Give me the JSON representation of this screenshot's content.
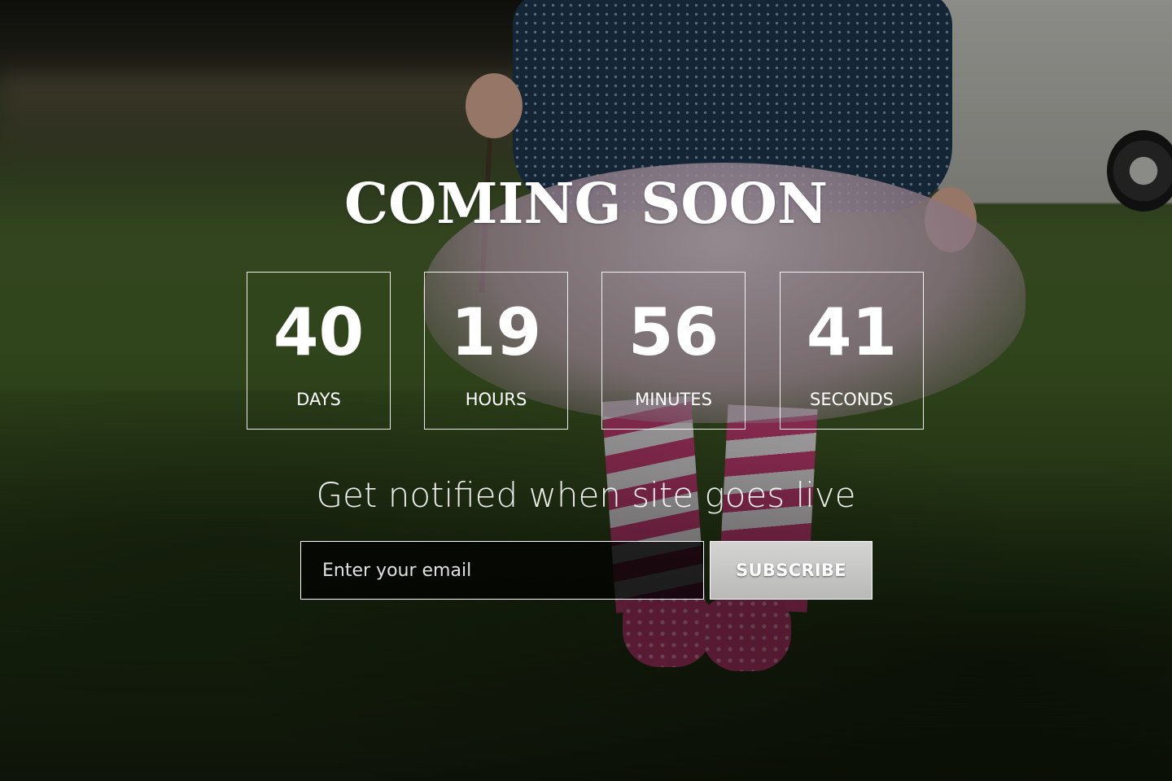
{
  "hero": {
    "title": "COMING SOON",
    "subtitle": "Get notified when site goes live"
  },
  "countdown": [
    {
      "value": "40",
      "label": "DAYS"
    },
    {
      "value": "19",
      "label": "HOURS"
    },
    {
      "value": "56",
      "label": "MINUTES"
    },
    {
      "value": "41",
      "label": "SECONDS"
    }
  ],
  "form": {
    "email_placeholder": "Enter your email",
    "email_value": "",
    "subscribe_label": "SUBSCRIBE"
  },
  "colors": {
    "text": "#ffffff",
    "button_bg": "#c8c8c6",
    "input_bg": "#000000"
  }
}
